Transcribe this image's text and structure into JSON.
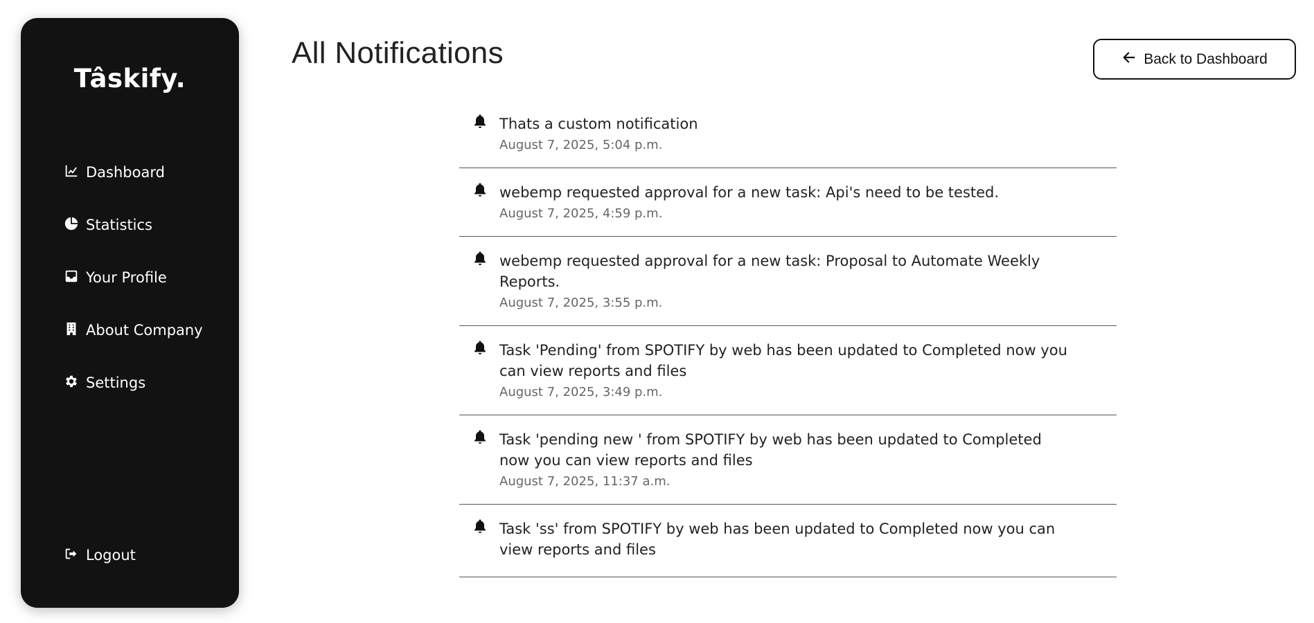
{
  "sidebar": {
    "brand": "Tâskify.",
    "items": [
      {
        "label": "Dashboard",
        "icon": "chart-line-icon"
      },
      {
        "label": "Statistics",
        "icon": "pie-chart-icon"
      },
      {
        "label": "Your Profile",
        "icon": "inbox-icon"
      },
      {
        "label": "About Company",
        "icon": "building-icon"
      },
      {
        "label": "Settings",
        "icon": "gear-icon"
      }
    ],
    "logout": {
      "label": "Logout",
      "icon": "logout-icon"
    }
  },
  "header": {
    "title": "All Notifications",
    "back_button": "Back to Dashboard"
  },
  "notifications": [
    {
      "message": "Thats a custom notification",
      "time": "August 7, 2025, 5:04 p.m."
    },
    {
      "message": "webemp requested approval for a new task: Api's need to be tested.",
      "time": "August 7, 2025, 4:59 p.m."
    },
    {
      "message": "webemp requested approval for a new task: Proposal to Automate Weekly Reports.",
      "time": "August 7, 2025, 3:55 p.m."
    },
    {
      "message": "Task 'Pending' from SPOTIFY by web has been updated to Completed now you can view reports and files",
      "time": "August 7, 2025, 3:49 p.m."
    },
    {
      "message": "Task 'pending new ' from SPOTIFY by web has been updated to Completed now you can view reports and files",
      "time": "August 7, 2025, 11:37 a.m."
    },
    {
      "message": "Task 'ss' from SPOTIFY by web has been updated to Completed now you can view reports and files",
      "time": ""
    }
  ]
}
